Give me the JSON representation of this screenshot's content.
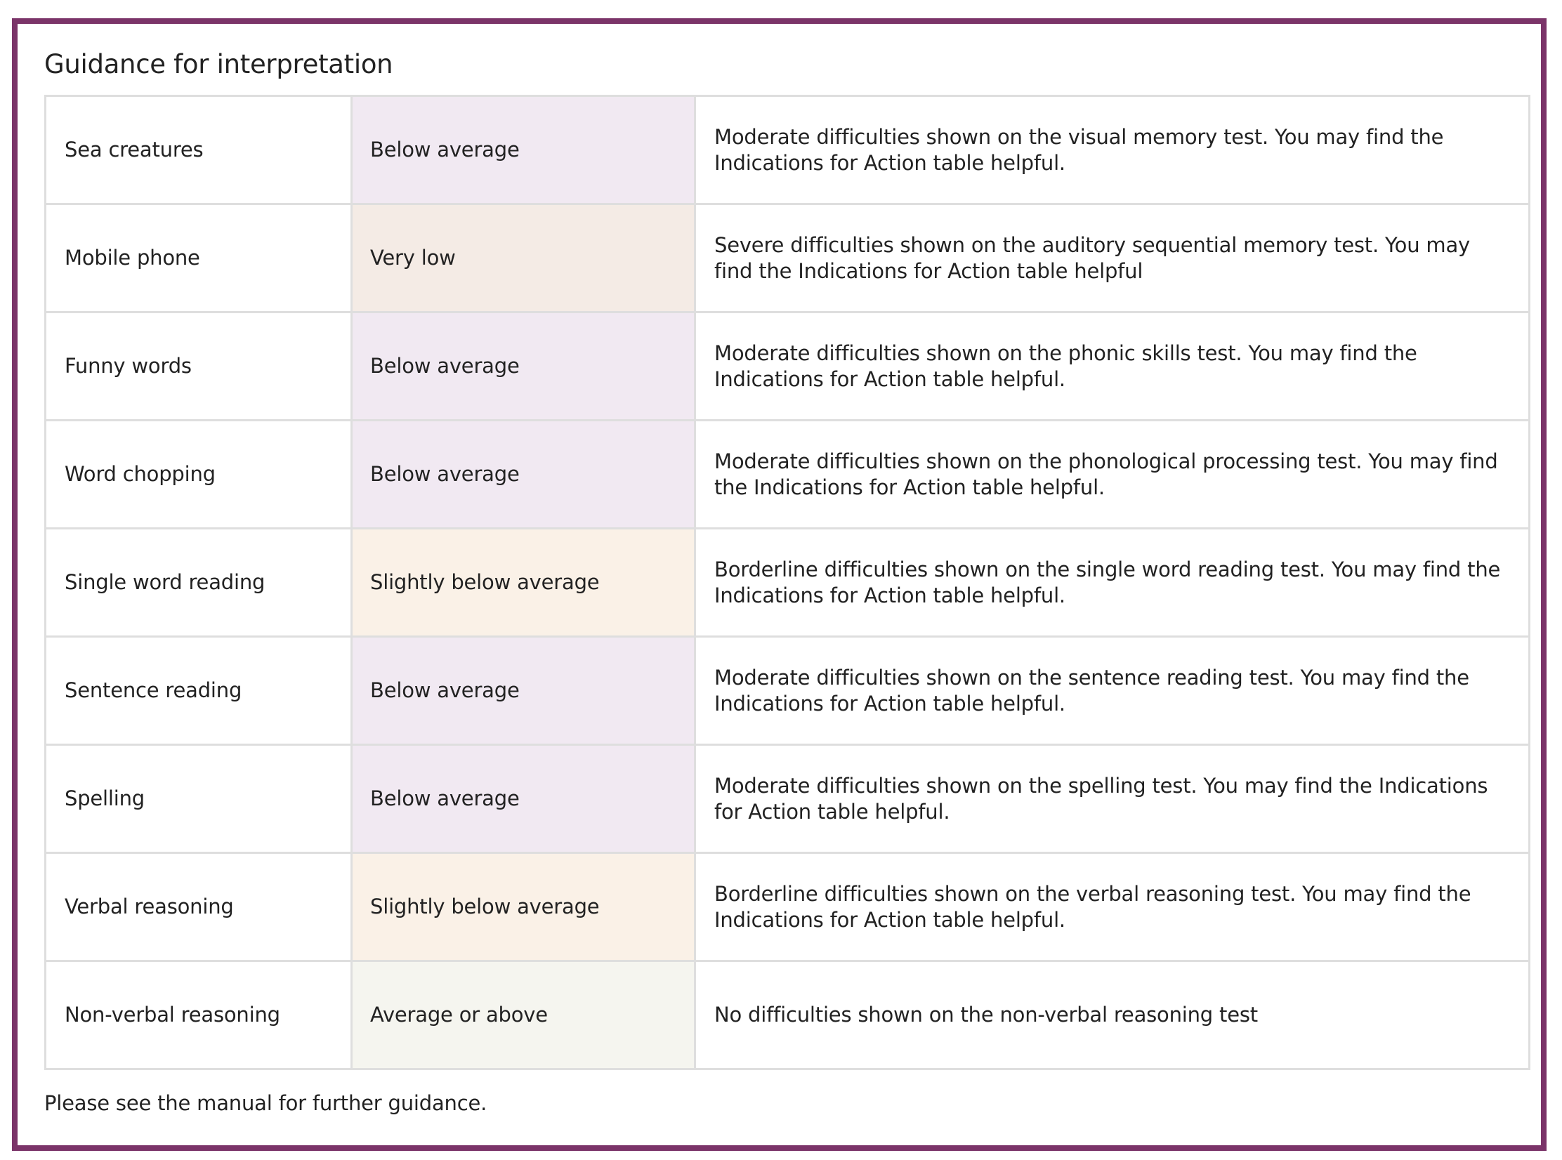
{
  "title": "Guidance for interpretation",
  "colors": {
    "frame": "#7b3469",
    "grid": "#dedede",
    "Below average": "#f1e9f2",
    "Very low": "#f4ebe5",
    "Slightly below average": "#faf1e7",
    "Average or above": "#f5f5ef"
  },
  "rows": [
    {
      "test": "Sea creatures",
      "rating": "Below average",
      "guidance": "Moderate difficulties shown on the visual memory test. You may find the Indications for Action table helpful."
    },
    {
      "test": "Mobile phone",
      "rating": "Very low",
      "guidance": "Severe difficulties shown on the auditory sequential memory test. You may find the Indications for Action table helpful"
    },
    {
      "test": "Funny words",
      "rating": "Below average",
      "guidance": "Moderate difficulties shown on the phonic skills test. You may find the Indications for Action table helpful."
    },
    {
      "test": "Word chopping",
      "rating": "Below average",
      "guidance": "Moderate difficulties shown on the phonological processing test. You may find the Indications for Action table helpful."
    },
    {
      "test": "Single word reading",
      "rating": "Slightly below average",
      "guidance": "Borderline difficulties shown on the single word reading test. You may find the Indications for Action table helpful."
    },
    {
      "test": "Sentence reading",
      "rating": "Below average",
      "guidance": "Moderate difficulties shown on the sentence reading test. You may find the Indications for Action table helpful."
    },
    {
      "test": "Spelling",
      "rating": "Below average",
      "guidance": "Moderate difficulties shown on the spelling test. You may find the Indications for Action table helpful."
    },
    {
      "test": "Verbal reasoning",
      "rating": "Slightly below average",
      "guidance": "Borderline difficulties shown on the verbal reasoning test. You may find the Indications for Action table helpful."
    },
    {
      "test": "Non-verbal reasoning",
      "rating": "Average or above",
      "guidance": "No difficulties shown on the non-verbal reasoning test"
    }
  ],
  "footer": "Please see the manual for further guidance."
}
